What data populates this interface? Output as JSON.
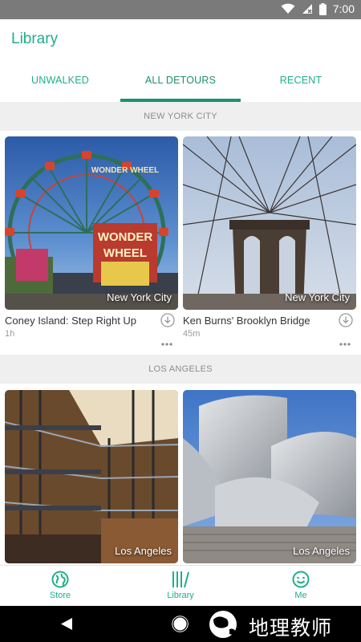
{
  "status_bar": {
    "time": "7:00"
  },
  "header": {
    "title": "Library"
  },
  "tabs": [
    {
      "label": "UNWALKED",
      "active": false
    },
    {
      "label": "ALL DETOURS",
      "active": true
    },
    {
      "label": "RECENT",
      "active": false
    }
  ],
  "sections": [
    {
      "title": "NEW YORK CITY",
      "cards": [
        {
          "city": "New York City",
          "title": "Coney Island: Step Right Up",
          "duration": "1h",
          "sign_top": "WONDER WHEEL",
          "sign_main_1": "WONDER",
          "sign_main_2": "WHEEL"
        },
        {
          "city": "New York City",
          "title": "Ken Burns' Brooklyn Bridge",
          "duration": "45m"
        }
      ]
    },
    {
      "title": "LOS ANGELES",
      "cards": [
        {
          "city": "Los Angeles"
        },
        {
          "city": "Los Angeles"
        }
      ]
    }
  ],
  "bottom_nav": [
    {
      "label": "Store",
      "icon": "globe-icon"
    },
    {
      "label": "Library",
      "icon": "library-icon"
    },
    {
      "label": "Me",
      "icon": "smiley-icon"
    }
  ],
  "watermark": {
    "text": "地理教师"
  },
  "colors": {
    "accent": "#1fae8a",
    "tab_indicator": "#1e8f73",
    "status_bar": "#7a7a7a"
  }
}
